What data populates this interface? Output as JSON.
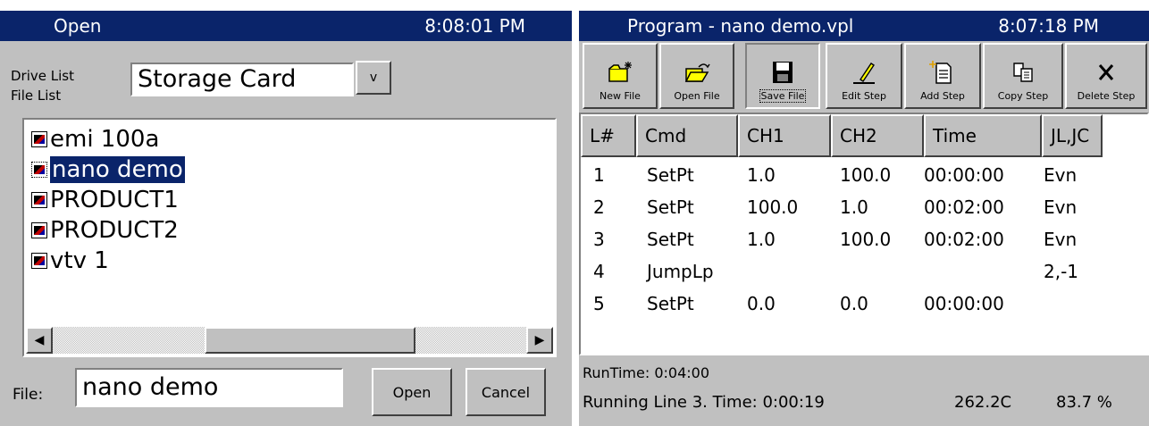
{
  "open_dialog": {
    "title": "Open",
    "clock": "8:08:01 PM",
    "drive_label": "Drive List",
    "file_list_label": "File List",
    "drive_value": "Storage Card",
    "drive_button": "v",
    "files": [
      "emi 100a",
      "nano demo",
      "PRODUCT1",
      "PRODUCT2",
      "vtv 1"
    ],
    "selected_file": "nano demo",
    "file_label": "File:",
    "file_value": "nano demo",
    "open_button": "Open",
    "cancel_button": "Cancel"
  },
  "program": {
    "title": "Program - nano demo.vpl",
    "clock": "8:07:18 PM",
    "toolbar": {
      "new_file": "New File",
      "open_file": "Open File",
      "save_file": "Save File",
      "edit_step": "Edit Step",
      "add_step": "Add Step",
      "copy_step": "Copy Step",
      "delete_step": "Delete Step"
    },
    "columns": [
      "L#",
      "Cmd",
      "CH1",
      "CH2",
      "Time",
      "JL,JC"
    ],
    "rows": [
      [
        "1",
        "SetPt",
        "1.0",
        "100.0",
        "00:00:00",
        "Evn"
      ],
      [
        "2",
        "SetPt",
        "100.0",
        "1.0",
        "00:02:00",
        "Evn"
      ],
      [
        "3",
        "SetPt",
        "1.0",
        "100.0",
        "00:02:00",
        "Evn"
      ],
      [
        "4",
        "JumpLp",
        "",
        "",
        "",
        "2,-1"
      ],
      [
        "5",
        "SetPt",
        "0.0",
        "0.0",
        "00:00:00",
        ""
      ]
    ],
    "status": {
      "runtime": "RunTime:  0:04:00",
      "running": "Running Line 3.  Time: 0:00:19",
      "temperature": "262.2C",
      "percent": "83.7 %"
    }
  }
}
